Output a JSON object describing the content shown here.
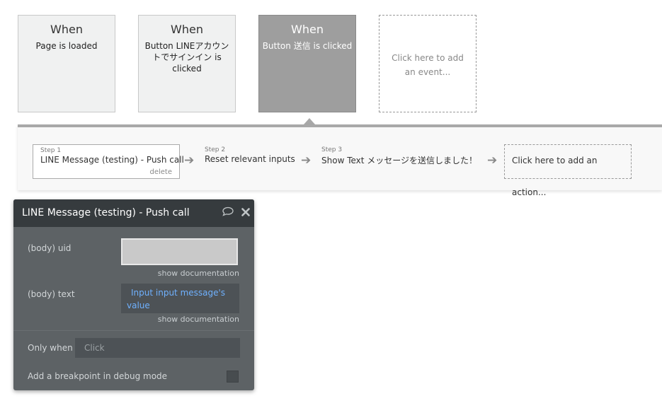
{
  "events": [
    {
      "when": "When",
      "description": "Page is loaded"
    },
    {
      "when": "When",
      "description": "Button LINEアカウントでサインイン is clicked"
    },
    {
      "when": "When",
      "description": "Button 送信 is clicked"
    },
    {
      "add_label": "Click here to add an event..."
    }
  ],
  "steps": [
    {
      "step_label": "Step 1",
      "title": "LINE Message (testing) - Push call",
      "delete_label": "delete"
    },
    {
      "step_label": "Step 2",
      "title": "Reset relevant inputs"
    },
    {
      "step_label": "Step 3",
      "title": "Show Text メッセージを送信しました！"
    }
  ],
  "add_action_label": "Click here to add an action...",
  "panel": {
    "title": "LINE Message (testing) - Push call",
    "uid_label": "(body) uid",
    "uid_value": "",
    "text_label": "(body) text",
    "text_value": "Input input message's value",
    "show_doc_label": "show documentation",
    "only_when_label": "Only when",
    "only_when_placeholder": "Click",
    "breakpoint_label": "Add a breakpoint in debug mode"
  },
  "colors": {
    "active_event": "#9e9e9e",
    "panel_bg": "#5d6265",
    "panel_header": "#363b3e",
    "dynamic_text": "#6fb1ff"
  },
  "icons": [
    "arrow-right-icon",
    "comment-icon",
    "close-icon"
  ]
}
